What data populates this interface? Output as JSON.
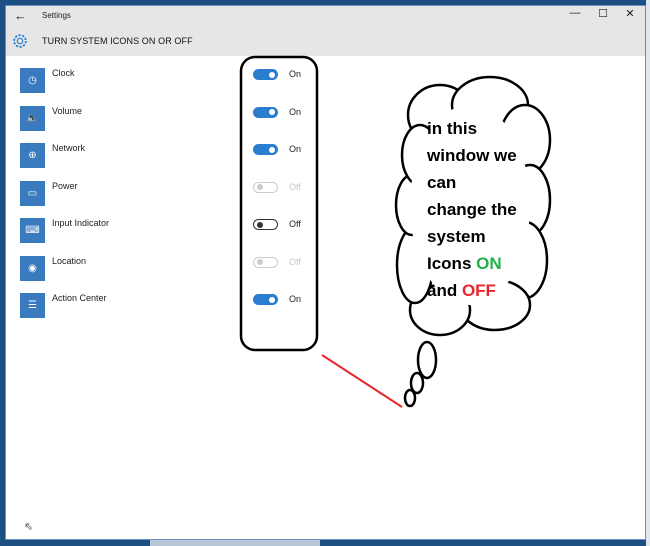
{
  "window": {
    "title": "Settings",
    "page_title": "TURN SYSTEM ICONS ON OR OFF",
    "controls": {
      "minimize": "—",
      "maximize": "☐",
      "close": "✕"
    },
    "back": "←"
  },
  "items": [
    {
      "label": "Clock",
      "icon": "clock-icon",
      "glyph": "◷",
      "state": "On",
      "mode": "on"
    },
    {
      "label": "Volume",
      "icon": "volume-icon",
      "glyph": "🔈",
      "state": "On",
      "mode": "on"
    },
    {
      "label": "Network",
      "icon": "network-icon",
      "glyph": "⊕",
      "state": "On",
      "mode": "on"
    },
    {
      "label": "Power",
      "icon": "power-icon",
      "glyph": "▭",
      "state": "Off",
      "mode": "dis"
    },
    {
      "label": "Input Indicator",
      "icon": "keyboard-icon",
      "glyph": "⌨",
      "state": "Off",
      "mode": "off"
    },
    {
      "label": "Location",
      "icon": "location-icon",
      "glyph": "◉",
      "state": "Off",
      "mode": "dis"
    },
    {
      "label": "Action Center",
      "icon": "action-center-icon",
      "glyph": "☰",
      "state": "On",
      "mode": "on"
    }
  ],
  "annotation": {
    "line1": "in this",
    "line2": "window we",
    "line3": "can",
    "line4": "change the",
    "line5": "system",
    "line6a": "Icons ",
    "line6b": "ON",
    "line7a": "and ",
    "line7b": "OFF"
  },
  "colors": {
    "accent": "#2b7dd0",
    "on_word": "#22b04a",
    "off_word": "#e8262b"
  }
}
